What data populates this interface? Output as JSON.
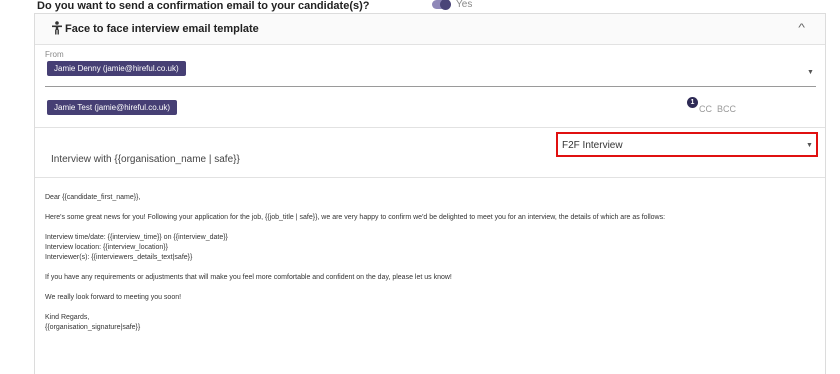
{
  "question": {
    "label": "Do you want to send a confirmation email to your candidate(s)?",
    "toggle_label": "Yes"
  },
  "template": {
    "title": "Face to face interview email template"
  },
  "from": {
    "label": "From",
    "value": "Jamie Denny (jamie@hireful.co.uk)"
  },
  "to": {
    "chip": "Jamie Test (jamie@hireful.co.uk)"
  },
  "recipients": {
    "count": "1",
    "cc": "CC",
    "bcc": "BCC"
  },
  "subject": "Interview with {{organisation_name | safe}}",
  "template_select": {
    "value": "F2F Interview"
  },
  "body": {
    "greeting": "Dear {{candidate_first_name}},",
    "intro": "Here's some great news for you! Following your application for the job, {{job_title | safe}}, we are very happy to confirm we'd be delighted to meet you for an interview, the details of which are as follows:",
    "time": "Interview time/date: {{interview_time}} on {{interview_date}}",
    "location": "Interview location: {{interview_location}}",
    "interviewers": "Interviewer(s): {{interviewers_details_text|safe}}",
    "requirements": "If you have any requirements or adjustments that will make you feel more comfortable and confident on the day, please let us know!",
    "closing": "We really look forward to meeting you soon!",
    "signoff": "Kind Regards,",
    "signature": "{{organisation_signature|safe}}"
  }
}
